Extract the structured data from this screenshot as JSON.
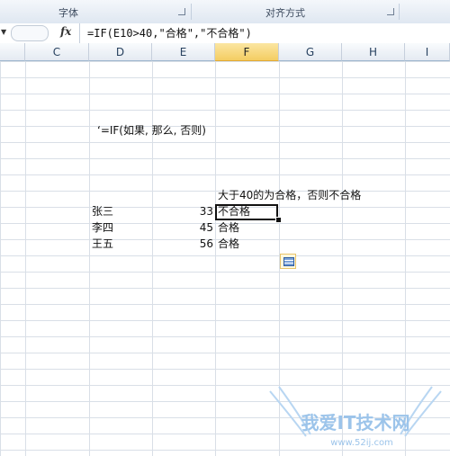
{
  "ribbon": {
    "groups": [
      "字体",
      "对齐方式"
    ]
  },
  "formula_bar": {
    "fx_label": "fx",
    "formula": "=IF(E10>40,\"合格\",\"不合格\")"
  },
  "columns": [
    {
      "id": "C",
      "selected": false
    },
    {
      "id": "D",
      "selected": false
    },
    {
      "id": "E",
      "selected": false
    },
    {
      "id": "F",
      "selected": true
    },
    {
      "id": "G",
      "selected": false
    },
    {
      "id": "H",
      "selected": false
    },
    {
      "id": "I",
      "selected": false
    }
  ],
  "cells": {
    "note": "‘=IF(如果, 那么, 否则)",
    "header_f": "大于40的为合格，否则不合格",
    "rows": [
      {
        "name": "张三",
        "score": "33",
        "result": "不合格"
      },
      {
        "name": "李四",
        "score": "45",
        "result": "合格"
      },
      {
        "name": "王五",
        "score": "56",
        "result": "合格"
      }
    ]
  },
  "watermark": {
    "text": "我爱IT技术网",
    "url": "www.52ij.com"
  },
  "colors": {
    "selected_header": "#f4cd62",
    "grid": "#d9dfe7",
    "watermark": "#9cc4ea"
  }
}
